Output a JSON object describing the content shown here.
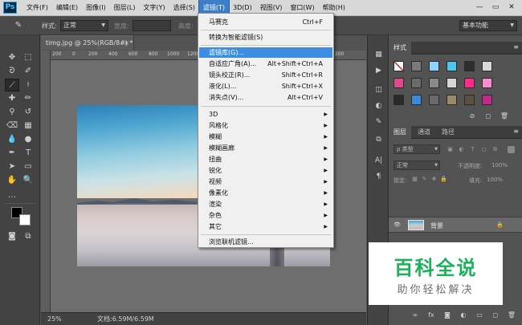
{
  "app": {
    "logo": "Ps"
  },
  "menubar": {
    "items": [
      "文件(F)",
      "编辑(E)",
      "图像(I)",
      "图层(L)",
      "文字(Y)",
      "选择(S)",
      "滤镜(T)",
      "3D(D)",
      "视图(V)",
      "窗口(W)",
      "帮助(H)"
    ],
    "active_index": 6,
    "window_buttons": [
      "—",
      "▭",
      "✕"
    ]
  },
  "optionsbar": {
    "style_label": "样式:",
    "style_value": "正常",
    "width_label": "宽度:",
    "height_label": "高度:",
    "workspace": "基本功能"
  },
  "document": {
    "tab_title": "timg.jpg @ 25%(RGB/8#) *",
    "tab_close": "×",
    "ruler_labels": [
      "200",
      "0",
      "200",
      "400",
      "600",
      "800",
      "1000",
      "1200",
      "1400",
      "1600",
      "1800",
      "2000",
      "2200"
    ],
    "zoom": "25%",
    "doc_info": "文档:6.59M/6.59M"
  },
  "filter_menu": {
    "items": [
      {
        "label": "马赛克",
        "shortcut": "Ctrl+F"
      },
      {
        "label": "转换为智能滤镜(S)"
      },
      {
        "label": "滤镜库(G)...",
        "highlighted": true
      },
      {
        "label": "自适应广角(A)...",
        "shortcut": "Alt+Shift+Ctrl+A"
      },
      {
        "label": "镜头校正(R)...",
        "shortcut": "Shift+Ctrl+R"
      },
      {
        "label": "液化(L)...",
        "shortcut": "Shift+Ctrl+X"
      },
      {
        "label": "消失点(V)...",
        "shortcut": "Alt+Ctrl+V"
      },
      {
        "label": "3D",
        "submenu": true
      },
      {
        "label": "风格化",
        "submenu": true
      },
      {
        "label": "模糊",
        "submenu": true
      },
      {
        "label": "模糊画廊",
        "submenu": true
      },
      {
        "label": "扭曲",
        "submenu": true
      },
      {
        "label": "锐化",
        "submenu": true
      },
      {
        "label": "视频",
        "submenu": true
      },
      {
        "label": "像素化",
        "submenu": true
      },
      {
        "label": "渲染",
        "submenu": true
      },
      {
        "label": "杂色",
        "submenu": true
      },
      {
        "label": "其它",
        "submenu": true
      },
      {
        "label": "浏览联机滤镜..."
      }
    ]
  },
  "styles_panel": {
    "tab": "样式",
    "swatch_colors": [
      [
        "#ffffff",
        "#7a7a7a",
        "#8fd3ff",
        "#4ac8f0",
        "#2e2e2e",
        "#d9d9d9"
      ],
      [
        "#e04a8a",
        "#6a6a6a",
        "#8a8a8a",
        "#d6d6d6",
        "#ff2a8a",
        "#ff8cd0"
      ],
      [
        "#2a2a2a",
        "#3a8ad8",
        "#6a6a6a",
        "#9a8a6a",
        "#5a5040",
        "#c02a8a"
      ]
    ]
  },
  "layers_panel": {
    "tabs": [
      "图层",
      "通道",
      "路径"
    ],
    "filter_kind": "ρ 类型",
    "blend_mode": "正常",
    "opacity_label": "不透明度:",
    "opacity_value": "100%",
    "lock_label": "锁定:",
    "fill_label": "填充:",
    "fill_value": "100%",
    "layer_name": "背景"
  },
  "watermark": {
    "title": "百科全说",
    "subtitle": "助你轻松解决"
  }
}
